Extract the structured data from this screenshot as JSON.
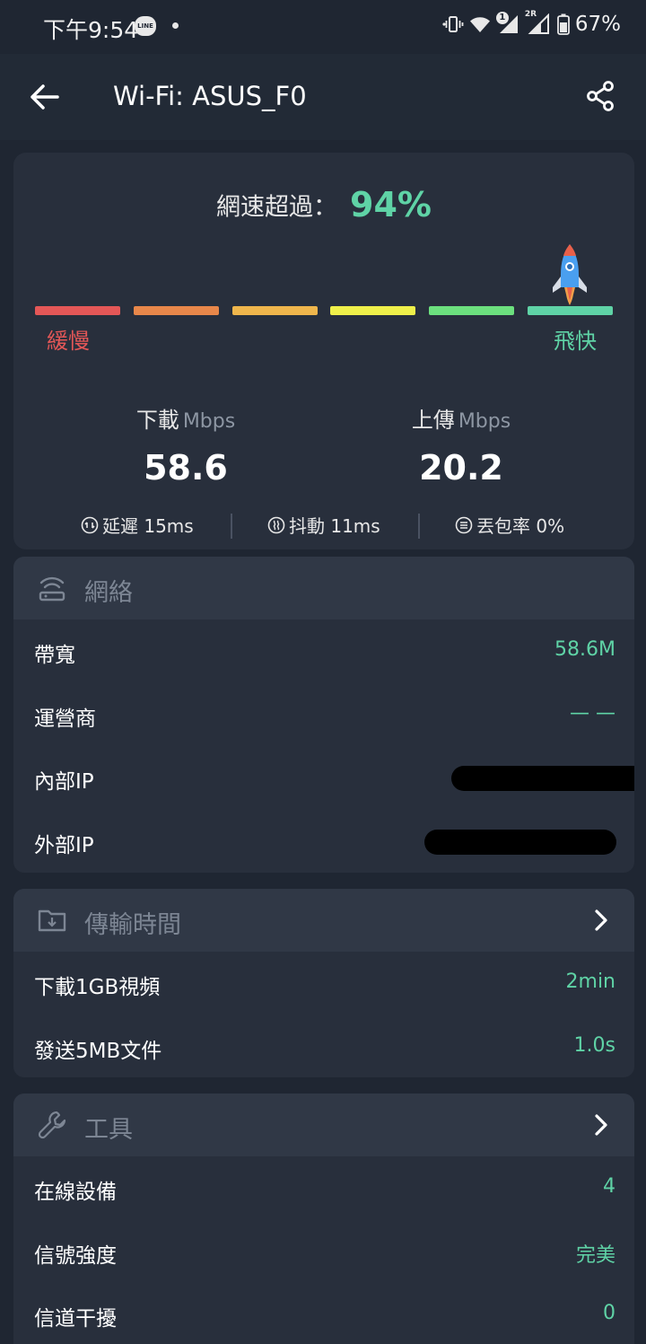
{
  "status_bar": {
    "time": "下午9:54",
    "line_badge": "LINE",
    "sim1_badge": "1",
    "sim2_badge": "2R",
    "battery": "67%"
  },
  "header": {
    "title": "Wi-Fi: ASUS_F0"
  },
  "speed": {
    "exceed_label": "網速超過：",
    "exceed_value": "94%",
    "percentile": 94,
    "bar_colors": [
      "#e45757",
      "#e8874a",
      "#efb64c",
      "#eff04a",
      "#6ce07e",
      "#5fd3a6"
    ],
    "slow_label": "緩慢",
    "fast_label": "飛快",
    "download_label": "下載",
    "download_unit": "Mbps",
    "download_value": "58.6",
    "upload_label": "上傳",
    "upload_unit": "Mbps",
    "upload_value": "20.2",
    "latency_label": "延遲 15ms",
    "jitter_label": "抖動 11ms",
    "loss_label": "丟包率 0%"
  },
  "network": {
    "title": "網絡",
    "rows": [
      {
        "label": "帶寬",
        "value": "58.6M"
      },
      {
        "label": "運營商",
        "value": "— —"
      },
      {
        "label": "內部IP",
        "value": ""
      },
      {
        "label": "外部IP",
        "value": ""
      }
    ]
  },
  "transfer": {
    "title": "傳輸時間",
    "rows": [
      {
        "label": "下載1GB視頻",
        "value": "2min"
      },
      {
        "label": "發送5MB文件",
        "value": "1.0s"
      }
    ]
  },
  "tools": {
    "title": "工具",
    "rows": [
      {
        "label": "在線設備",
        "value": "4"
      },
      {
        "label": "信號強度",
        "value": "完美"
      },
      {
        "label": "信道干擾",
        "value": "0"
      }
    ]
  },
  "colors": {
    "accent": "#5fd3a6",
    "background": "#1f2632",
    "card": "#282f3c",
    "slow": "#e45757"
  }
}
